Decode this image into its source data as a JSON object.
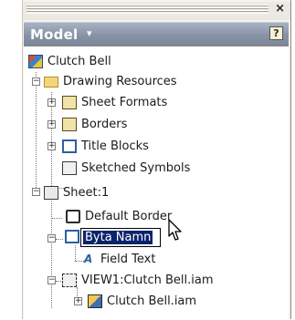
{
  "panel": {
    "title": "Model",
    "title_caret": "▾",
    "help_label": "?",
    "close_label": "×"
  },
  "tree": {
    "root": "Clutch Bell",
    "drawing_resources": "Drawing Resources",
    "sheet_formats": "Sheet Formats",
    "borders": "Borders",
    "title_blocks": "Title Blocks",
    "sketched_symbols": "Sketched Symbols",
    "sheet": "Sheet:1",
    "default_border": "Default Border",
    "rename_value": "Byta Namn",
    "field_text": "Field Text",
    "view": "VIEW1:Clutch Bell.iam",
    "assembly": "Clutch Bell.iam"
  },
  "colors": {
    "title_bar": "#8893a6",
    "selection": "#0a246a",
    "panel_bg": "#f4f2ec"
  }
}
